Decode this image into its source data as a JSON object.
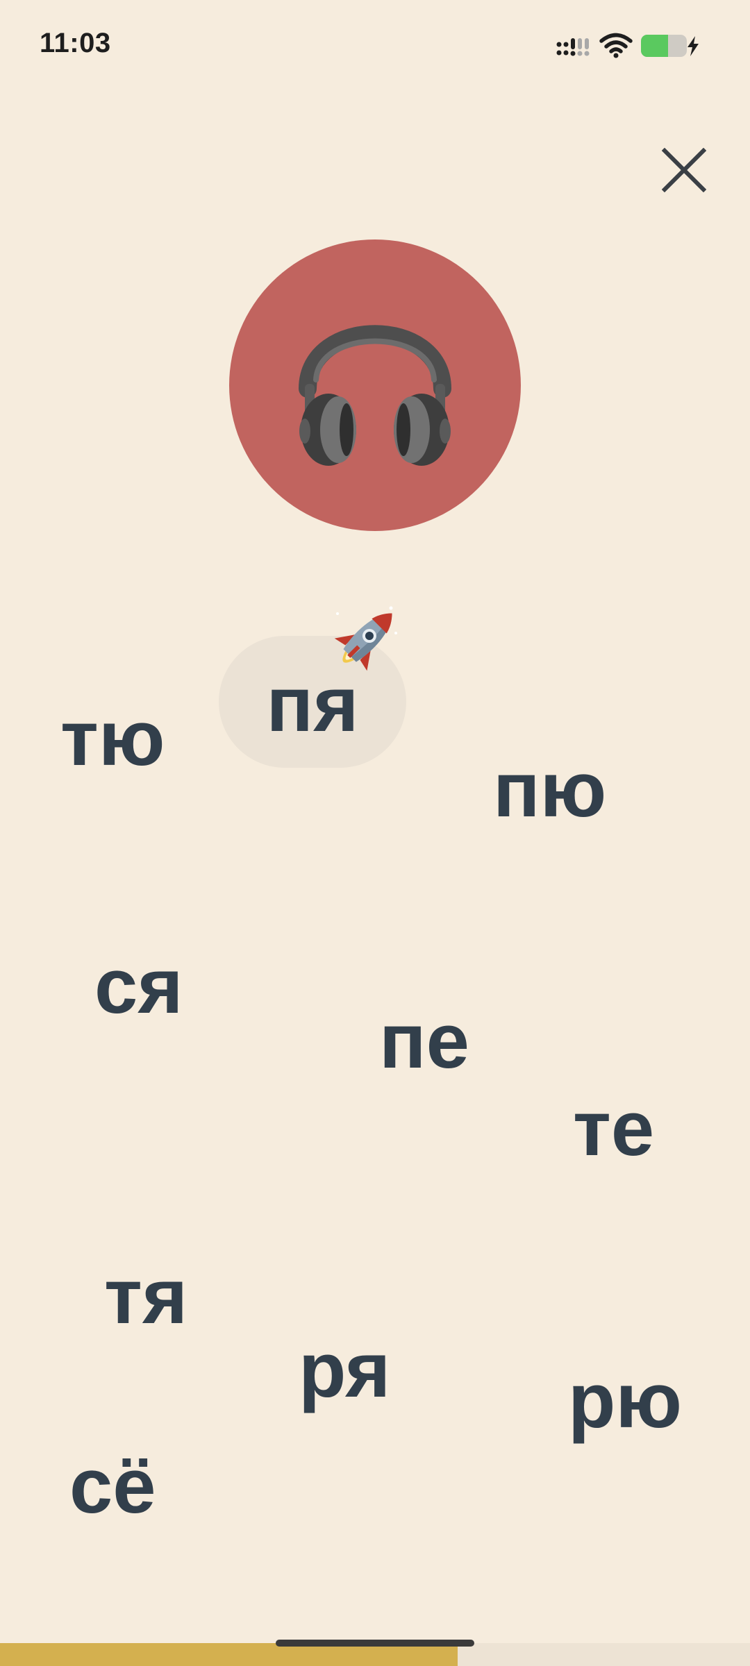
{
  "status_bar": {
    "time": "11:03",
    "icons": [
      "signal-icon",
      "wifi-icon",
      "battery-charging-icon"
    ],
    "battery_color": "#5AC95F"
  },
  "header": {
    "close_icon": "close-icon"
  },
  "audio": {
    "icon": "headphones-icon",
    "circle_color": "#C1645F"
  },
  "rocket": {
    "icon": "rocket-icon"
  },
  "syllables": {
    "pya": "пя",
    "tyu": "тю",
    "pyu": "пю",
    "sya": "ся",
    "pe": "пе",
    "te": "те",
    "tya": "тя",
    "rya": "ря",
    "ryu": "рю",
    "syo": "сё",
    "selected": "пя"
  },
  "progress": {
    "fraction": 0.61,
    "fill_color": "#D4B04F"
  },
  "colors": {
    "background": "#F6ECDD",
    "text": "#323F4B",
    "selected_pill": "#EBE2D5"
  }
}
